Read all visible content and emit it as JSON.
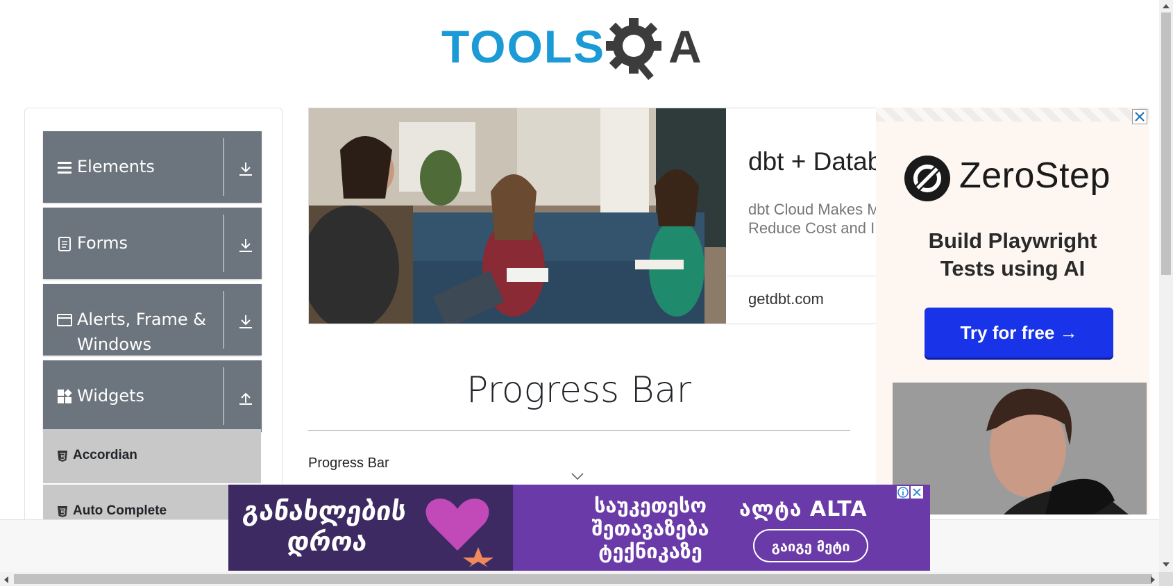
{
  "logo": {
    "text_tools": "TOOLS",
    "text_a": "A",
    "colors": {
      "blue": "#1b9ad6",
      "dark": "#3c3c3c"
    }
  },
  "nav": {
    "groups": [
      {
        "label": "Elements",
        "icon": "hamburger-icon",
        "arrow": "download-arrow-icon"
      },
      {
        "label": "Forms",
        "icon": "document-icon",
        "arrow": "download-arrow-icon"
      },
      {
        "label_line1": "Alerts, Frame &",
        "label_line2": "Windows",
        "icon": "window-icon",
        "arrow": "download-arrow-icon"
      },
      {
        "label": "Widgets",
        "icon": "widgets-icon",
        "arrow": "upload-arrow-icon"
      }
    ],
    "widget_items": [
      {
        "label": "Accordian",
        "icon": "html5-icon"
      },
      {
        "label": "Auto Complete",
        "icon": "html5-icon"
      }
    ],
    "colors": {
      "group_bg": "#6c757d",
      "item_bg": "#c8c8c8"
    }
  },
  "ad_center": {
    "title": "dbt + Datab",
    "description": "dbt Cloud Makes M Reduce Cost and I",
    "url": "getdbt.com"
  },
  "main": {
    "title": "Progress Bar",
    "breadcrumb": "Progress Bar"
  },
  "ad_right": {
    "brand": "ZeroStep",
    "headline_line1": "Build Playwright",
    "headline_line2": "Tests using AI",
    "cta": "Try for free →",
    "colors": {
      "cta_bg": "#1934e8"
    }
  },
  "banner": {
    "left_line1": "განახლების",
    "left_line2": "დროა",
    "mid_line1": "საუკეთესო",
    "mid_line2": "შეთავაზება",
    "mid_line3": "ტექნიკაზე",
    "brand": "ალტა ALTA",
    "button": "გაიგე მეტი",
    "colors": {
      "bg": "#6a3aa8"
    }
  }
}
